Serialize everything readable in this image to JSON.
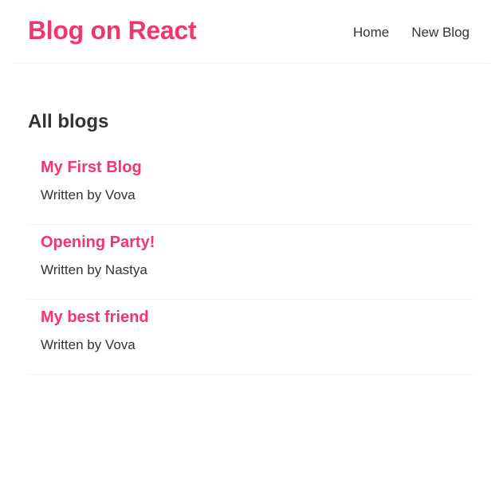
{
  "brand": {
    "title": "Blog on React",
    "color": "#f1356d"
  },
  "nav": {
    "links": [
      {
        "label": "Home"
      },
      {
        "label": "New Blog"
      }
    ]
  },
  "main": {
    "heading": "All blogs",
    "blogs": [
      {
        "title": "My First Blog",
        "author_line": "Written by Vova"
      },
      {
        "title": "Opening Party!",
        "author_line": "Written by Nastya"
      },
      {
        "title": "My best friend",
        "author_line": "Written by Vova"
      }
    ]
  }
}
